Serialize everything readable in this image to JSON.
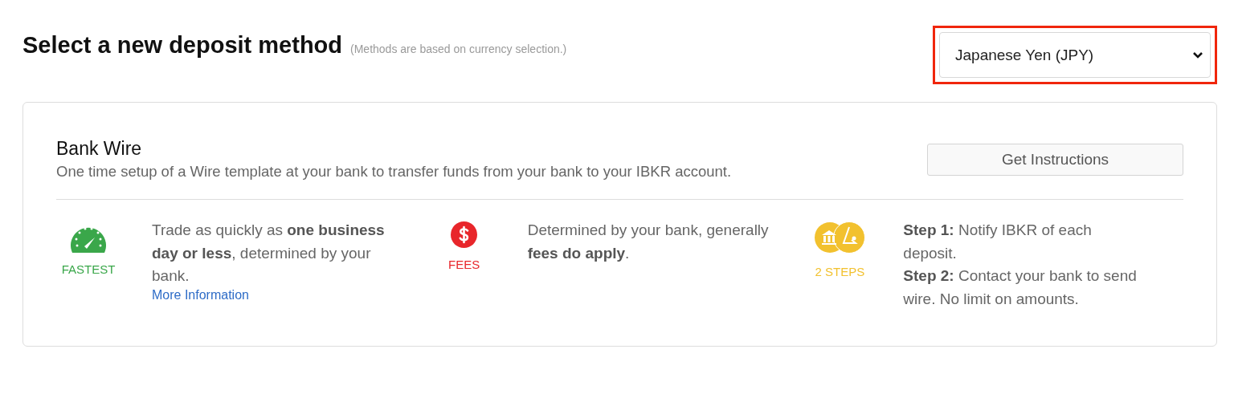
{
  "header": {
    "title": "Select a new deposit method",
    "note": "(Methods are based on currency selection.)"
  },
  "currency_select": {
    "value": "Japanese Yen (JPY)",
    "highlighted": true
  },
  "method": {
    "title": "Bank Wire",
    "description": "One time setup of a Wire template at your bank to transfer funds from your bank to your IBKR account.",
    "button": "Get Instructions",
    "features": [
      {
        "kind": "speed",
        "label": "FASTEST",
        "color": "#3aa74a",
        "lines": [
          "Trade as quickly as **one business day or less**, determined by your bank."
        ],
        "link": "More Information"
      },
      {
        "kind": "fees",
        "label": "FEES",
        "color": "#e8262b",
        "lines": [
          "Determined by your bank, generally **fees do apply**."
        ]
      },
      {
        "kind": "steps",
        "label": "2 STEPS",
        "color": "#f2c12e",
        "lines": [
          "**Step 1:** Notify IBKR of each deposit.",
          "**Step 2:** Contact your bank to send wire. No limit on amounts."
        ]
      }
    ]
  }
}
